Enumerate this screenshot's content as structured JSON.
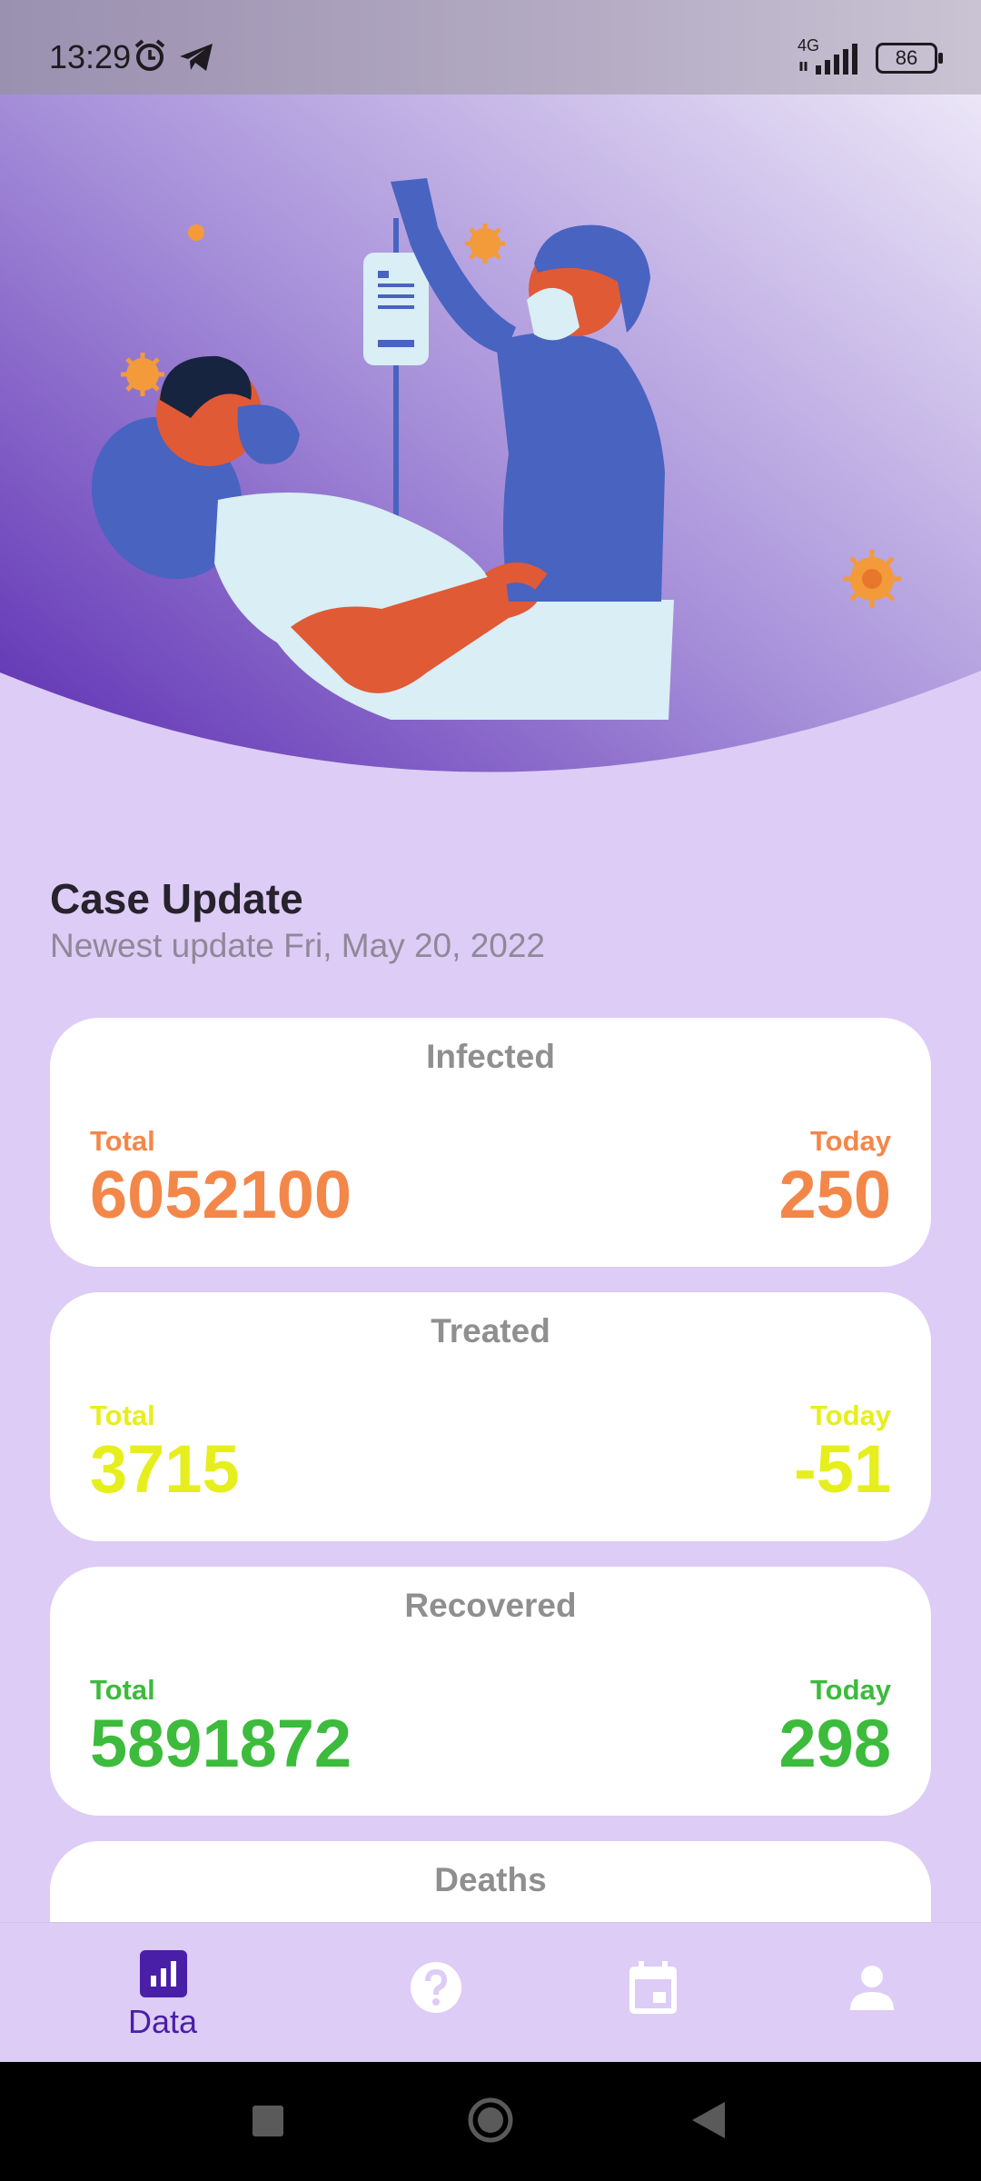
{
  "status_bar": {
    "time": "13:29",
    "network": "4G",
    "battery": "86",
    "icons": [
      "alarm-icon",
      "telegram-icon",
      "signal-icon",
      "battery-icon"
    ]
  },
  "case_update": {
    "title": "Case Update",
    "subtitle": "Newest update Fri, May 20, 2022"
  },
  "cards": [
    {
      "title": "Infected",
      "total_label": "Total",
      "today_label": "Today",
      "total": "6052100",
      "today": "250",
      "color": "#f3874a"
    },
    {
      "title": "Treated",
      "total_label": "Total",
      "today_label": "Today",
      "total": "3715",
      "today": "-51",
      "color": "#e6ef1d"
    },
    {
      "title": "Recovered",
      "total_label": "Total",
      "today_label": "Today",
      "total": "5891872",
      "today": "298",
      "color": "#3cbb3c"
    },
    {
      "title": "Deaths"
    }
  ],
  "bottom_nav": {
    "items": [
      {
        "label": "Data",
        "icon": "chart-icon",
        "active": true
      },
      {
        "icon": "help-icon"
      },
      {
        "icon": "calendar-icon"
      },
      {
        "icon": "person-icon"
      }
    ]
  },
  "colors": {
    "accent": "#4a1fa8",
    "page_bg": "#ddccf6",
    "hero_purple": "#6a3fc0",
    "infected": "#f3874a",
    "treated": "#e6ef1d",
    "recovered": "#3cbb3c"
  }
}
